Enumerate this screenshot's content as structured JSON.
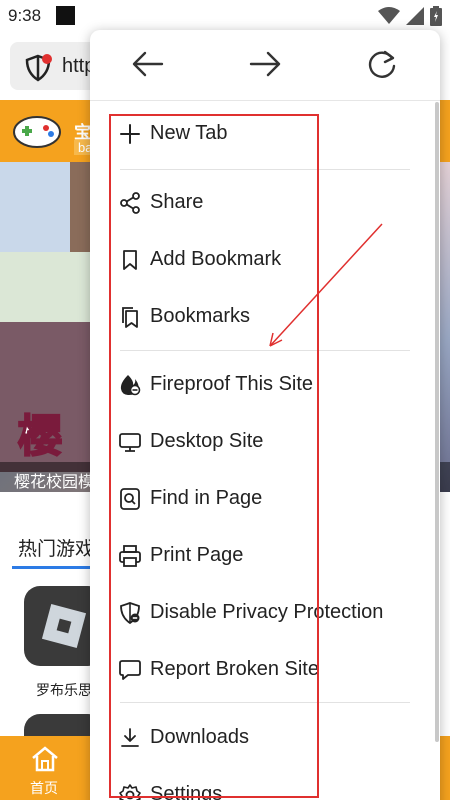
{
  "status_bar": {
    "time": "9:38"
  },
  "address_bar": {
    "url_text": "http"
  },
  "page": {
    "site_name": "宝贝",
    "site_sub": "bac",
    "banner_big_text": "樱",
    "banner_caption": "樱花校园模",
    "hot_title": "热门游戏",
    "app_label": "罗布乐思",
    "home_label": "首页"
  },
  "menu": {
    "nav": {
      "back": "back-icon",
      "forward": "forward-icon",
      "reload": "reload-icon"
    },
    "items": [
      {
        "label": "New Tab",
        "icon": "plus-icon"
      },
      {
        "label": "Share",
        "icon": "share-icon"
      },
      {
        "label": "Add Bookmark",
        "icon": "bookmark-icon"
      },
      {
        "label": "Bookmarks",
        "icon": "bookmarks-icon"
      },
      {
        "label": "Fireproof This Site",
        "icon": "fireproof-icon"
      },
      {
        "label": "Desktop Site",
        "icon": "desktop-icon"
      },
      {
        "label": "Find in Page",
        "icon": "find-icon"
      },
      {
        "label": "Print Page",
        "icon": "printer-icon"
      },
      {
        "label": "Disable Privacy Protection",
        "icon": "privacy-shield-icon"
      },
      {
        "label": "Report Broken Site",
        "icon": "report-icon"
      },
      {
        "label": "Downloads",
        "icon": "download-icon"
      },
      {
        "label": "Settings",
        "icon": "settings-icon"
      }
    ]
  },
  "colors": {
    "accent_orange": "#f5a21e",
    "annotation_red": "#e0302f",
    "tab_blue": "#2c7be5"
  }
}
